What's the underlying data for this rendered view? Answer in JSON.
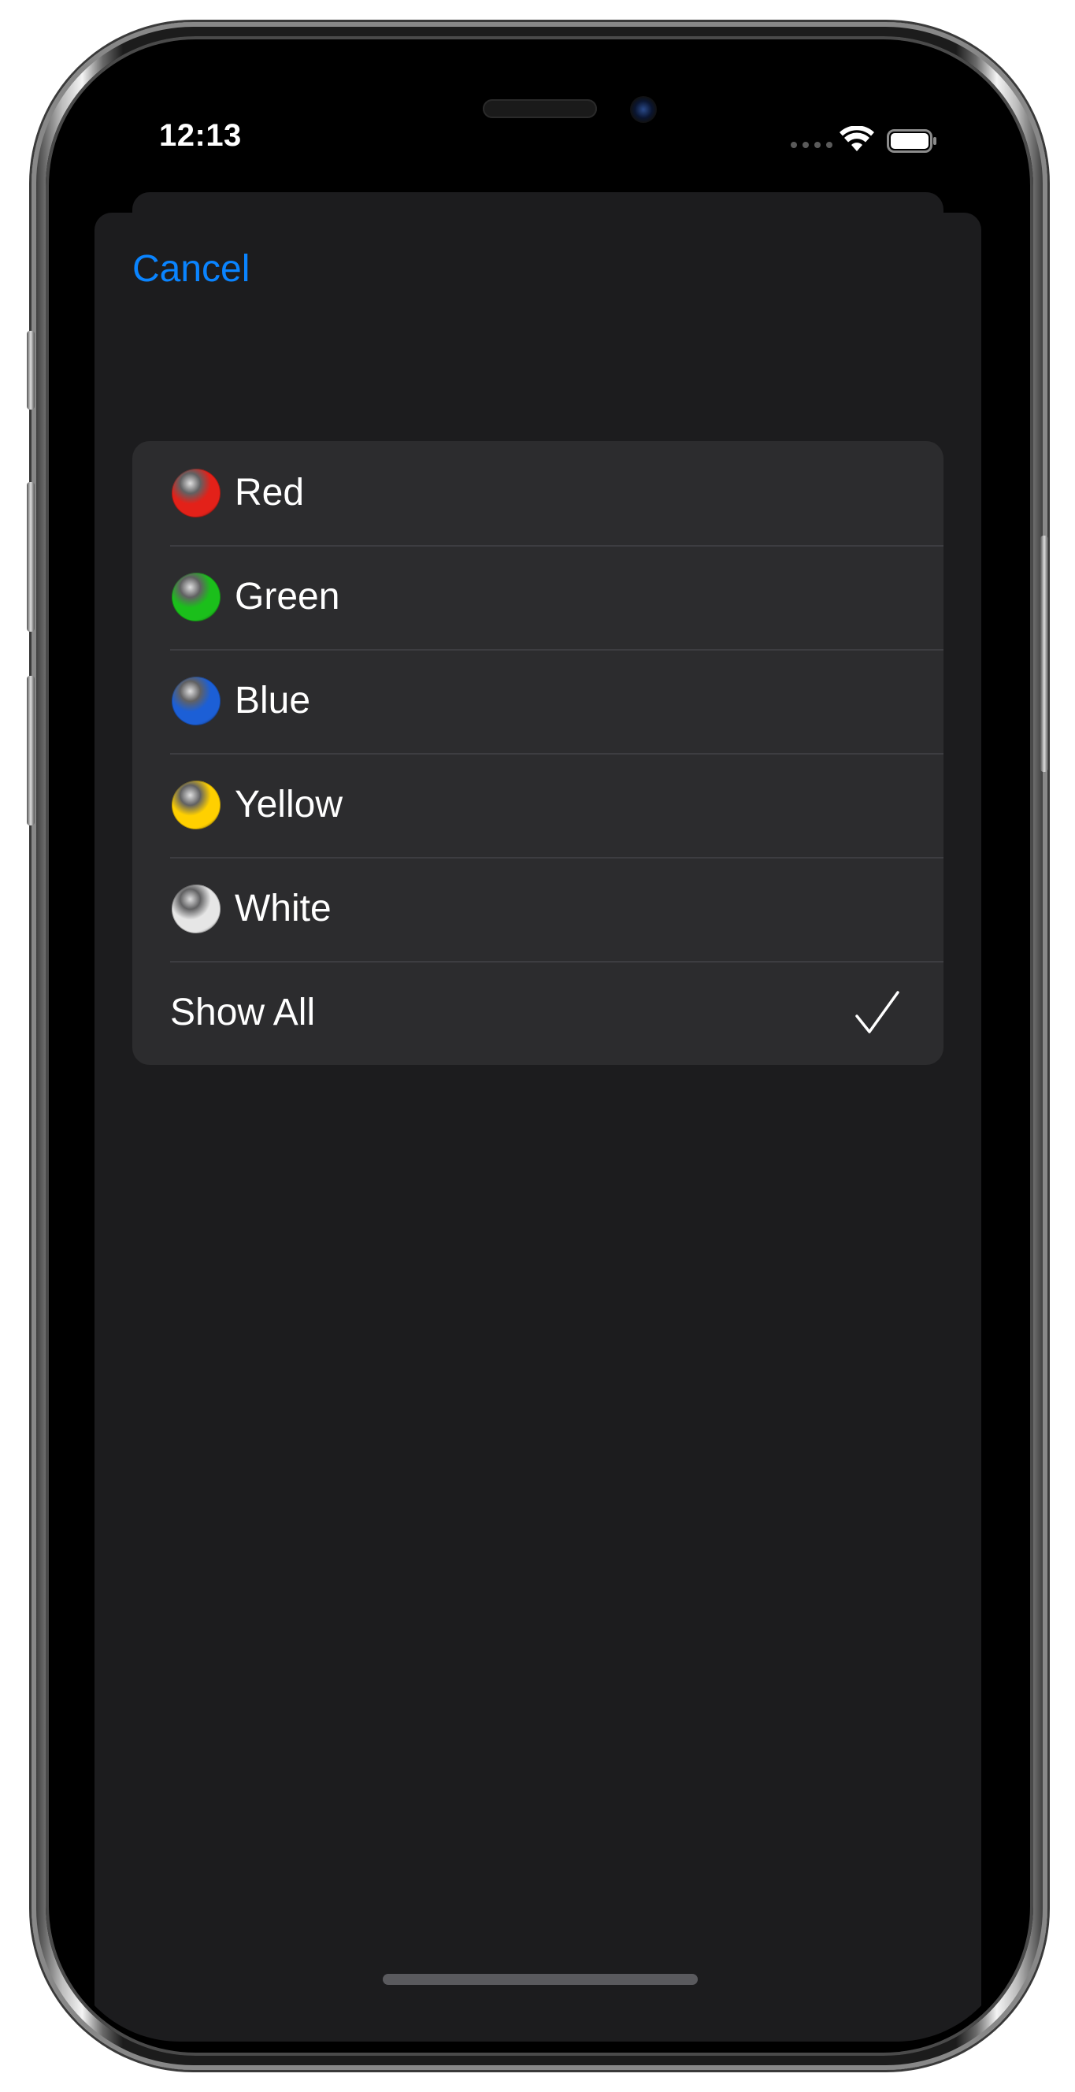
{
  "status_bar": {
    "time": "12:13"
  },
  "sheet": {
    "cancel_label": "Cancel"
  },
  "color_options": [
    {
      "label": "Red",
      "color": "#e32119",
      "icon": "red-dot-icon"
    },
    {
      "label": "Green",
      "color": "#1bbf1b",
      "icon": "green-dot-icon"
    },
    {
      "label": "Blue",
      "color": "#1c5fd6",
      "icon": "blue-dot-icon"
    },
    {
      "label": "Yellow",
      "color": "#ffd000",
      "icon": "yellow-dot-icon"
    },
    {
      "label": "White",
      "color": "#e6e6e6",
      "icon": "white-dot-icon"
    }
  ],
  "show_all": {
    "label": "Show All",
    "selected": true,
    "icon": "checkmark-icon"
  },
  "theme": {
    "accent": "#0a84ff",
    "sheet_background": "#1c1c1e",
    "card_background": "#2c2c2e",
    "separator": "#3d3d41"
  }
}
